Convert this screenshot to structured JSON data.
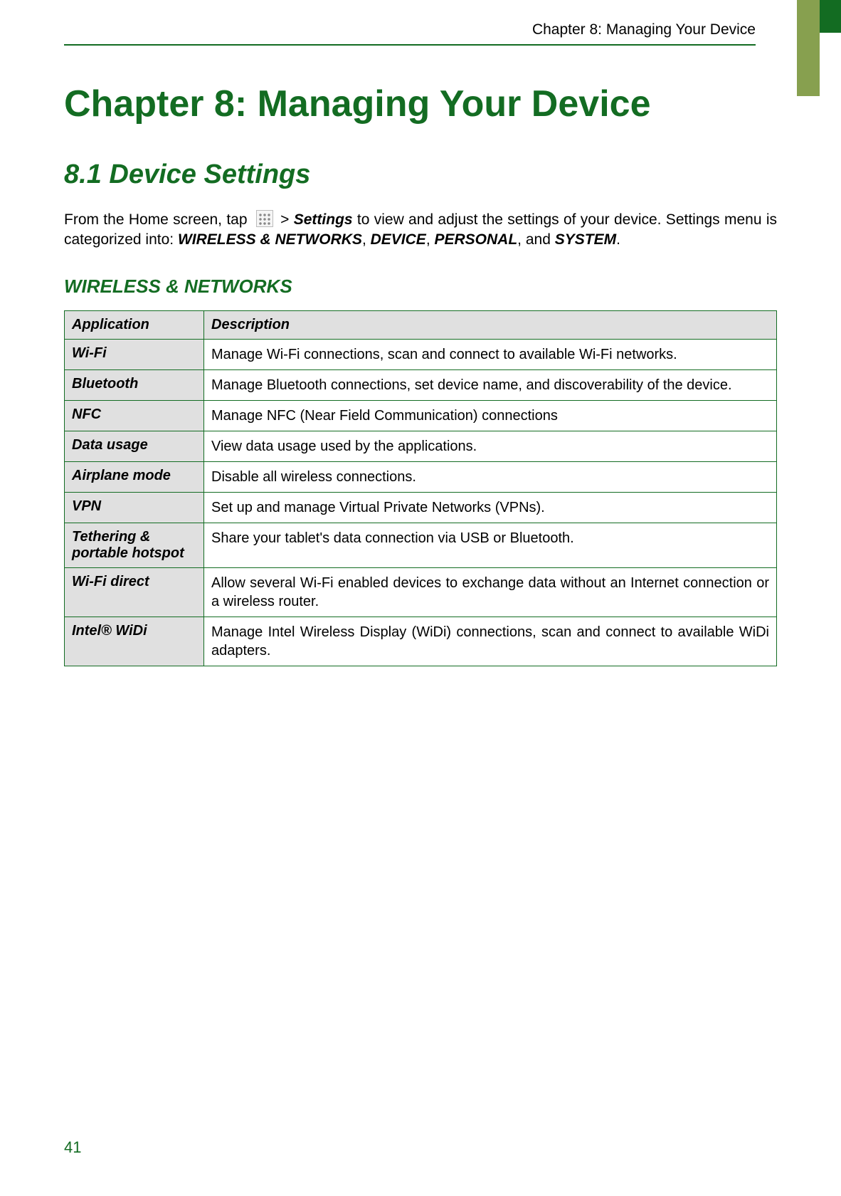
{
  "header": {
    "running": "Chapter 8: Managing Your Device"
  },
  "chapter": {
    "title": "Chapter 8: Managing Your Device"
  },
  "section": {
    "title": "8.1 Device Settings",
    "intro_prefix": "From the Home screen, tap ",
    "intro_gt": " > ",
    "intro_settings": "Settings",
    "intro_mid": " to view and adjust the settings of your device. Settings menu is categorized into: ",
    "cat1": "WIRELESS & NETWORKS",
    "cat2": "DEVICE",
    "cat3": "PERSONAL",
    "cat4": "SYSTEM",
    "intro_end": "."
  },
  "subsection": {
    "title": "WIRELESS & NETWORKS"
  },
  "table": {
    "headers": {
      "col1": "Application",
      "col2": "Description"
    },
    "rows": [
      {
        "app": "Wi-Fi",
        "desc": "Manage Wi-Fi connections, scan and connect to available Wi-Fi networks."
      },
      {
        "app": "Bluetooth",
        "desc": "Manage Bluetooth connections, set device name, and discoverability of the device."
      },
      {
        "app": "NFC",
        "desc": "Manage NFC (Near Field Communication) connections"
      },
      {
        "app": "Data usage",
        "desc": "View data usage used by the applications."
      },
      {
        "app": "Airplane mode",
        "desc": "Disable all wireless connections."
      },
      {
        "app": "VPN",
        "desc": "Set up and manage Virtual Private Networks (VPNs)."
      },
      {
        "app": "Tethering & portable hotspot",
        "desc": "Share your tablet's data connection via USB or Bluetooth."
      },
      {
        "app": "Wi-Fi direct",
        "desc": "Allow several Wi-Fi enabled devices to exchange data without an Internet connection or a wireless router."
      },
      {
        "app": "Intel® WiDi",
        "desc": "Manage Intel Wireless Display (WiDi) connections, scan and connect to available WiDi adapters."
      }
    ]
  },
  "footer": {
    "page": "41"
  }
}
